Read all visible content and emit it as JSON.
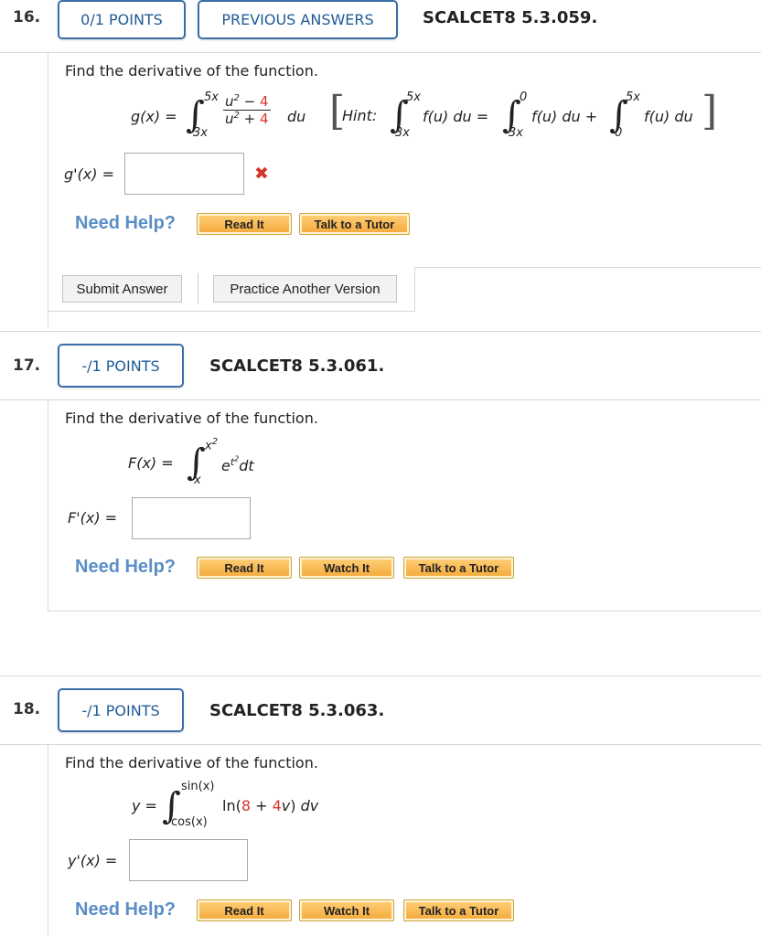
{
  "q16": {
    "number": "16.",
    "points": "0/1 POINTS",
    "previous_answers": "PREVIOUS ANSWERS",
    "code": "SCALCET8 5.3.059.",
    "prompt": "Find the derivative of the function.",
    "lhs": "g(x) =",
    "upper": "5x",
    "lower": "3x",
    "num_var": "u",
    "num_exp": "2",
    "num_op": " − ",
    "num_const": "4",
    "den_var": "u",
    "den_exp": "2",
    "den_op": " + ",
    "den_const": "4",
    "du": "du",
    "hint_label": "Hint:",
    "hint_upper1": "5x",
    "hint_lower1": "3x",
    "hint_term1": "f(u) du =",
    "hint_upper2": "0",
    "hint_lower2": "3x",
    "hint_term2": "f(u) du +",
    "hint_upper3": "5x",
    "hint_lower3": "0",
    "hint_term3": "f(u) du",
    "answer_label": "g'(x) =",
    "answer_value": "",
    "wrong_mark": "✖",
    "need_help": "Need Help?",
    "read_it": "Read It",
    "talk_to_tutor": "Talk to a Tutor",
    "submit_answer": "Submit Answer",
    "practice_another": "Practice Another Version"
  },
  "q17": {
    "number": "17.",
    "points": "-/1 POINTS",
    "code": "SCALCET8 5.3.061.",
    "prompt": "Find the derivative of the function.",
    "lhs": "F(x) =",
    "upper": "x",
    "upper_exp": "2",
    "lower": "x",
    "integrand_base": "e",
    "integrand_exp_var": "t",
    "integrand_exp_exp": "2",
    "dt": "dt",
    "answer_label": "F'(x) =",
    "answer_value": "",
    "need_help": "Need Help?",
    "read_it": "Read It",
    "watch_it": "Watch It",
    "talk_to_tutor": "Talk to a Tutor"
  },
  "q18": {
    "number": "18.",
    "points": "-/1 POINTS",
    "code": "SCALCET8 5.3.063.",
    "prompt": "Find the derivative of the function.",
    "lhs": "y =",
    "upper": "sin(x)",
    "lower": "cos(x)",
    "ln_open": "ln(",
    "c1": "8",
    "plus": " + ",
    "c2": "4",
    "var": "v",
    "close": ")",
    "dv": "dv",
    "answer_label": "y'(x) =",
    "answer_value": "",
    "need_help": "Need Help?",
    "read_it": "Read It",
    "watch_it": "Watch It",
    "talk_to_tutor": "Talk to a Tutor"
  },
  "colors": {
    "tab_border": "#3a6ea8",
    "tab_text": "#1f5a96",
    "need_help": "#5a8ec4",
    "wrong": "#d6352b",
    "coef_red": "#d6352b",
    "help_button": "#f4a93a"
  }
}
